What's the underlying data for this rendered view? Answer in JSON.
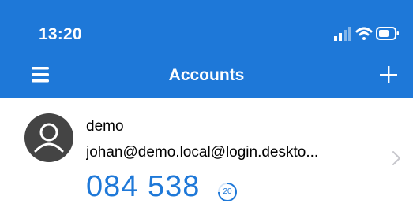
{
  "status_bar": {
    "time": "13:20"
  },
  "nav": {
    "title": "Accounts",
    "menu_icon": "hamburger-menu-icon",
    "add_icon": "plus-icon"
  },
  "account": {
    "name": "demo",
    "email": "johan@demo.local@login.deskto...",
    "code": "084 538",
    "seconds_remaining": "20",
    "avatar_icon": "user-avatar-icon",
    "chevron_icon": "chevron-right-icon"
  },
  "colors": {
    "brand": "#1e78d8",
    "avatar": "#444444"
  }
}
